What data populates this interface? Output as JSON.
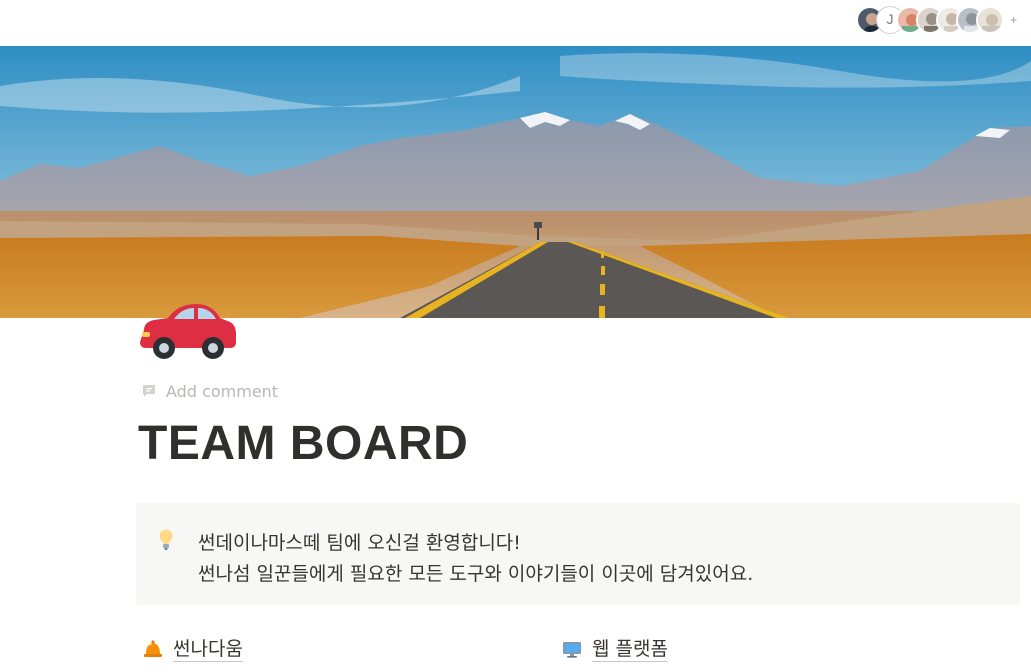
{
  "header": {
    "avatar_initial": "J",
    "add_label": "+"
  },
  "cover": {
    "icon": "road-landscape-image"
  },
  "page": {
    "icon": "red-car-emoji",
    "add_comment_label": "Add comment",
    "title": "TEAM BOARD"
  },
  "callout": {
    "icon": "light-bulb-emoji",
    "line1": "썬데이나마스떼 팀에 오신걸 환영합니다!",
    "line2": "썬나섬 일꾼들에게 필요한 모든 도구와 이야기들이 이곳에 담겨있어요."
  },
  "links": [
    {
      "icon": "bell-emoji",
      "label": "썬나다움"
    },
    {
      "icon": "computer-emoji",
      "label": "웹 플랫폼"
    }
  ]
}
